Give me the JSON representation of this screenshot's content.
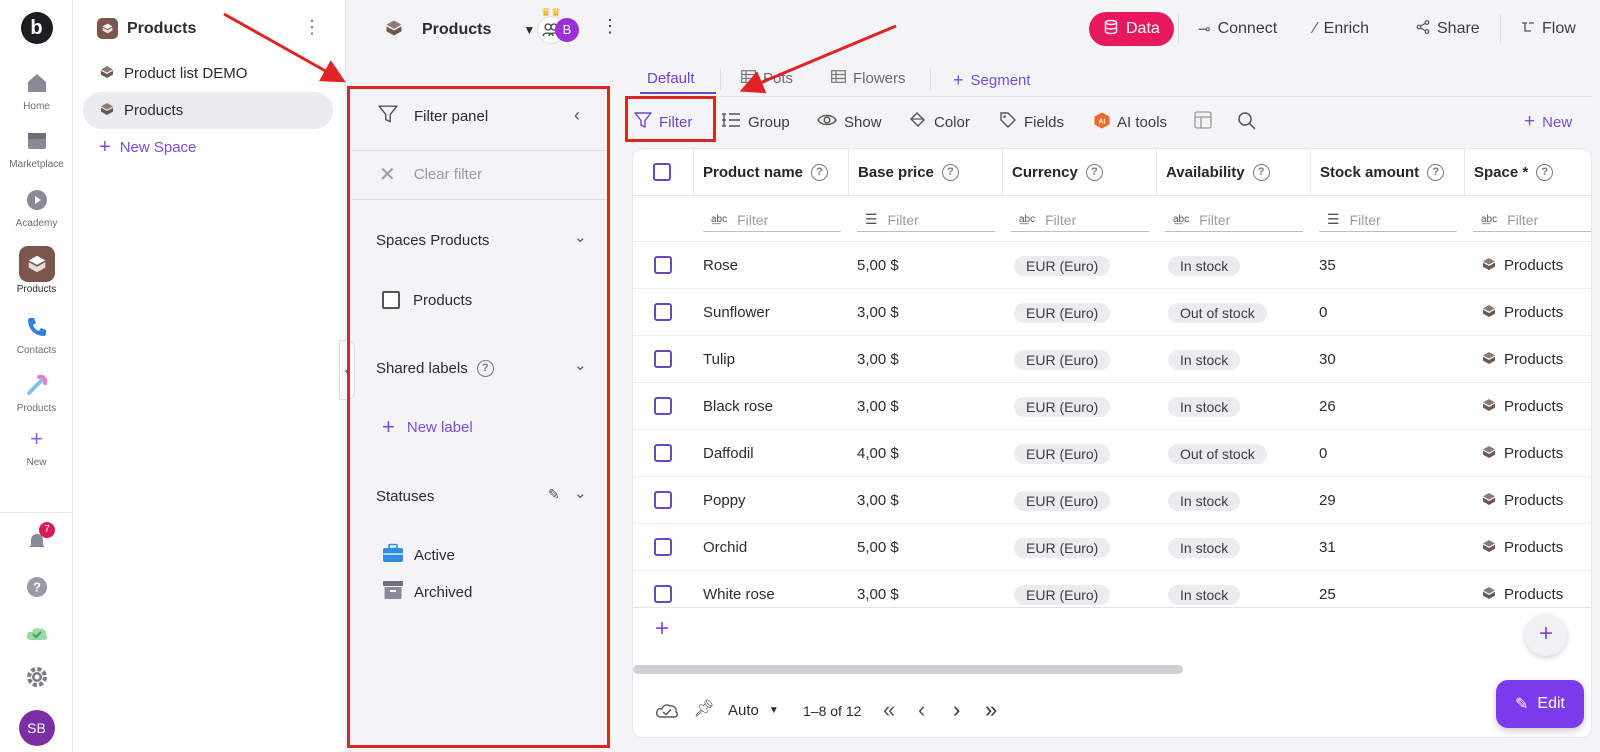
{
  "rail": {
    "items": [
      {
        "label": "Home"
      },
      {
        "label": "Marketplace"
      },
      {
        "label": "Academy"
      },
      {
        "label": "Products"
      },
      {
        "label": "Contacts"
      },
      {
        "label": "Products"
      },
      {
        "label": "New"
      }
    ],
    "notif_count": "7",
    "avatar": "SB",
    "logo": "b"
  },
  "spaces": {
    "title": "Products",
    "items": [
      {
        "label": "Product list DEMO"
      },
      {
        "label": "Products"
      }
    ],
    "new_space": "New Space"
  },
  "topbar": {
    "title": "Products",
    "avatar_letter": "B",
    "buttons": {
      "data": "Data",
      "connect": "Connect",
      "enrich": "Enrich",
      "share": "Share",
      "flow": "Flow"
    }
  },
  "tabs": [
    {
      "label": "Default"
    },
    {
      "label": "Pots"
    },
    {
      "label": "Flowers"
    },
    {
      "label": "Segment"
    }
  ],
  "toolbar": {
    "filter": "Filter",
    "group": "Group",
    "show": "Show",
    "color": "Color",
    "fields": "Fields",
    "ai_tools": "AI tools",
    "new": "New"
  },
  "filter_panel": {
    "title": "Filter panel",
    "clear": "Clear filter",
    "spaces_section": "Spaces Products",
    "spaces_option": "Products",
    "labels_section": "Shared labels",
    "new_label": "New label",
    "statuses_section": "Statuses",
    "status_active": "Active",
    "status_archived": "Archived"
  },
  "table": {
    "columns": [
      "Product name",
      "Base price",
      "Currency",
      "Availability",
      "Stock amount",
      "Space *"
    ],
    "filter_placeholder": "Filter",
    "rows": [
      {
        "name": "Rose",
        "price": "5,00 $",
        "currency": "EUR (Euro)",
        "availability": "In stock",
        "stock": "35",
        "space": "Products"
      },
      {
        "name": "Sunflower",
        "price": "3,00 $",
        "currency": "EUR (Euro)",
        "availability": "Out of stock",
        "stock": "0",
        "space": "Products"
      },
      {
        "name": "Tulip",
        "price": "3,00 $",
        "currency": "EUR (Euro)",
        "availability": "In stock",
        "stock": "30",
        "space": "Products"
      },
      {
        "name": "Black rose",
        "price": "3,00 $",
        "currency": "EUR (Euro)",
        "availability": "In stock",
        "stock": "26",
        "space": "Products"
      },
      {
        "name": "Daffodil",
        "price": "4,00 $",
        "currency": "EUR (Euro)",
        "availability": "Out of stock",
        "stock": "0",
        "space": "Products"
      },
      {
        "name": "Poppy",
        "price": "3,00 $",
        "currency": "EUR (Euro)",
        "availability": "In stock",
        "stock": "29",
        "space": "Products"
      },
      {
        "name": "Orchid",
        "price": "5,00 $",
        "currency": "EUR (Euro)",
        "availability": "In stock",
        "stock": "31",
        "space": "Products"
      },
      {
        "name": "White rose",
        "price": "3,00 $",
        "currency": "EUR (Euro)",
        "availability": "In stock",
        "stock": "25",
        "space": "Products"
      }
    ],
    "footer": {
      "row_height": "Auto",
      "pagination": "1–8 of 12"
    },
    "edit": "Edit"
  },
  "colors": {
    "accent": "#6b46c1",
    "data_pill": "#e8185f",
    "annotation": "#e02424"
  }
}
